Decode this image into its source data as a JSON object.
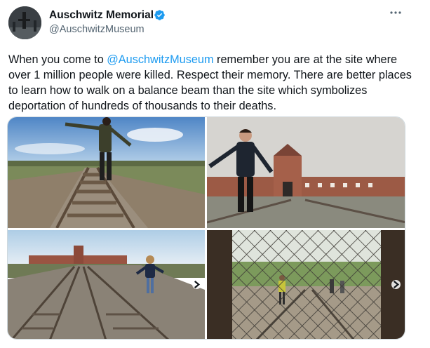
{
  "author": {
    "name": "Auschwitz Memorial",
    "handle": "@AuschwitzMuseum",
    "verified": true,
    "avatar_icon": "avatar-photo"
  },
  "actions": {
    "more_icon": "more-options-icon"
  },
  "tweet": {
    "text_before": "When you come to ",
    "mention": "@AuschwitzMuseum",
    "text_after": " remember you are at the  site where over 1 million people were killed. Respect their memory. There are better places to learn how to walk on a balance beam than the site which symbolizes deportation of hundreds of thousands to their deaths."
  },
  "media": {
    "photos": [
      {
        "subject": "woman balancing on railway track at Auschwitz-Birkenau"
      },
      {
        "subject": "man balancing on rail in front of Birkenau gate building"
      },
      {
        "subject": "woman in hat balancing on railway tracks toward gate"
      },
      {
        "subject": "person balancing on rails seen through wire fence"
      }
    ]
  },
  "colors": {
    "accent": "#1d9bf0",
    "text": "#0f1419",
    "muted": "#536471",
    "border": "#cfd9de"
  }
}
